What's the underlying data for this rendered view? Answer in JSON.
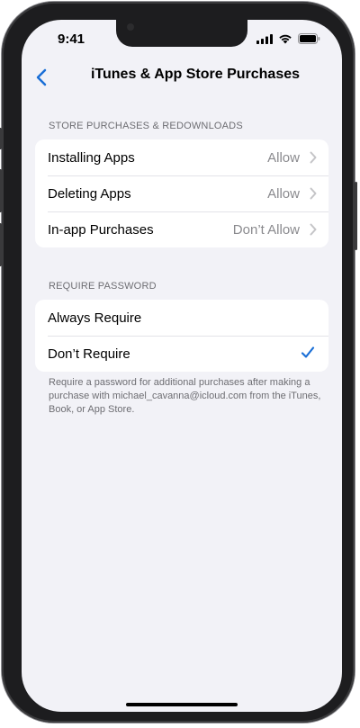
{
  "status_bar": {
    "time": "9:41",
    "icons": [
      "cellular-signal-icon",
      "wifi-icon",
      "battery-icon"
    ]
  },
  "nav": {
    "back_icon": "chevron-left-icon",
    "title": "iTunes & App Store Purchases"
  },
  "sections": {
    "store": {
      "header": "STORE PURCHASES & REDOWNLOADS",
      "rows": [
        {
          "label": "Installing Apps",
          "value": "Allow"
        },
        {
          "label": "Deleting Apps",
          "value": "Allow"
        },
        {
          "label": "In-app Purchases",
          "value": "Don’t Allow"
        }
      ]
    },
    "password": {
      "header": "REQUIRE PASSWORD",
      "rows": [
        {
          "label": "Always Require",
          "selected": false
        },
        {
          "label": "Don’t Require",
          "selected": true
        }
      ],
      "footer": "Require a password for additional purchases after making a purchase with michael_cavanna@icloud.com from the iTunes, Book, or App Store."
    }
  },
  "colors": {
    "accent": "#1a6fd6",
    "background": "#f2f2f7",
    "secondary_text": "#8a8a8e"
  }
}
